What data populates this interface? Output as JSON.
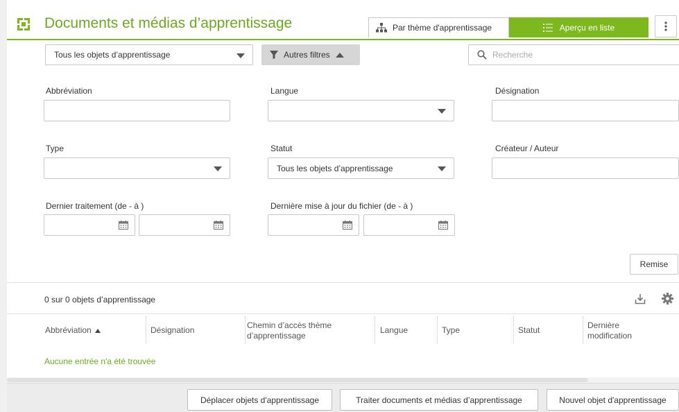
{
  "header": {
    "title": "Documents et médias d’apprentissage",
    "tab_theme": "Par thème d'apprentissage",
    "tab_list": "Aperçu en liste"
  },
  "filterbar": {
    "objects_select": "Tous les objets d’apprentissage",
    "more_filters": "Autres filtres",
    "search_placeholder": "Recherche"
  },
  "form": {
    "abbreviation_label": "Abbréviation",
    "langue_label": "Langue",
    "designation_label": "Désignation",
    "type_label": "Type",
    "statut_label": "Statut",
    "statut_value": "Tous les objets d’apprentissage",
    "createur_label": "Créateur / Auteur",
    "dernier_traitement_label": "Dernier traitement (de - à )",
    "derniere_maj_label": "Dernière mise à jour du fichier (de - à )",
    "reset_label": "Remise"
  },
  "results": {
    "count_text": "0 sur 0 objets d’apprentissage",
    "empty_text": "Aucune entrée n'a été trouvée"
  },
  "table": {
    "columns": [
      "Abbréviation",
      "Désignation",
      "Chemin d’accès thème d’apprentissage",
      "Langue",
      "Type",
      "Statut",
      "Dernière modification"
    ]
  },
  "footer": {
    "move_button": "Déplacer objets d'apprentissage",
    "process_button": "Traiter documents et médias d’apprentissage",
    "new_button": "Nouvel objet d'apprentissage"
  },
  "colors": {
    "accent": "#7db91e",
    "accent_text": "#6aab1e"
  },
  "icons": {
    "app": "learning-objects-icon",
    "theme_tab": "hierarchy-icon",
    "list_tab": "list-icon",
    "more": "vertical-dots-icon",
    "filter": "funnel-icon",
    "search": "magnifier-icon",
    "calendar": "calendar-icon",
    "export": "download-icon",
    "settings": "gear-icon"
  }
}
